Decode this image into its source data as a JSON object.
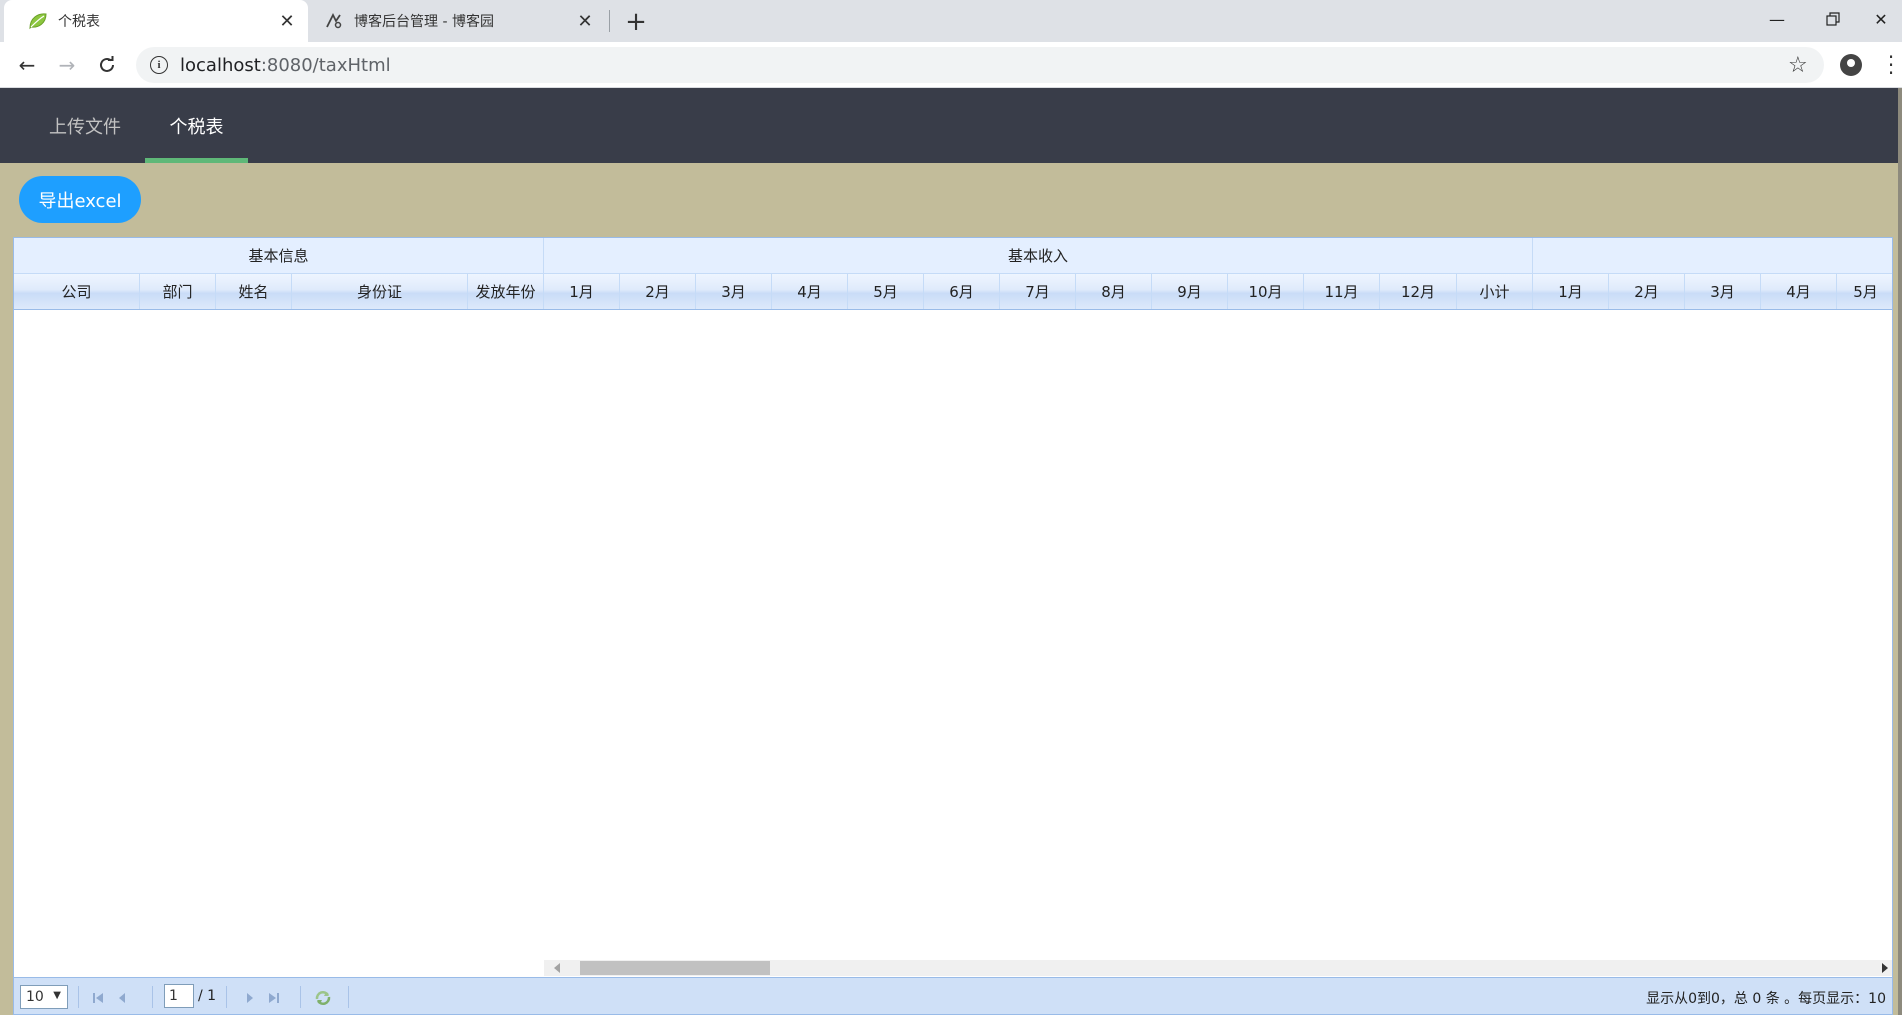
{
  "browser": {
    "tabs": [
      {
        "title": "个税表",
        "icon": "leaf-icon",
        "active": true
      },
      {
        "title": "博客后台管理 - 博客园",
        "icon": "cnblogs-icon",
        "active": false
      }
    ],
    "url_host": "localhost",
    "url_path": ":8080/taxHtml"
  },
  "app": {
    "nav": [
      {
        "label": "上传文件",
        "active": false
      },
      {
        "label": "个税表",
        "active": true
      }
    ],
    "export_label": "导出excel",
    "accent_color": "#1e9fff",
    "nav_active_color": "#5fb878"
  },
  "table": {
    "groups": [
      {
        "label": "基本信息"
      },
      {
        "label": "基本收入"
      },
      {
        "label": ""
      }
    ],
    "columns": [
      "公司",
      "部门",
      "姓名",
      "身份证",
      "发放年份",
      "1月",
      "2月",
      "3月",
      "4月",
      "5月",
      "6月",
      "7月",
      "8月",
      "9月",
      "10月",
      "11月",
      "12月",
      "小计",
      "1月",
      "2月",
      "3月",
      "4月",
      "5月"
    ]
  },
  "pager": {
    "page_size": "10",
    "current_page": "1",
    "total_pages": "/ 1",
    "info": "显示从0到0，总 0 条 。每页显示：10"
  }
}
